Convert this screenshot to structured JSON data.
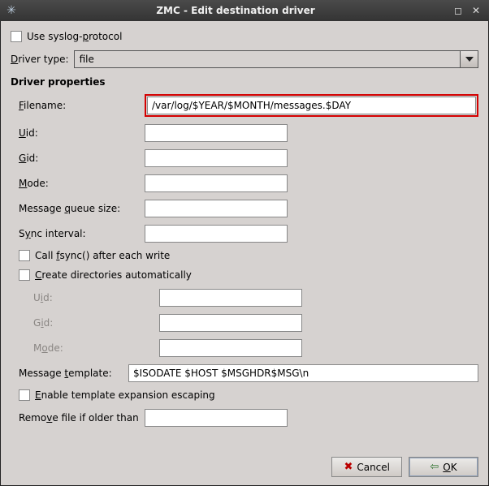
{
  "window": {
    "title": "ZMC - Edit destination driver"
  },
  "syslog_checkbox_label_pre": "Use syslog-",
  "syslog_checkbox_label_u": "p",
  "syslog_checkbox_label_post": "rotocol",
  "driver_type_label_u": "D",
  "driver_type_label_rest": "river type:",
  "driver_type_value": "file",
  "section_title": "Driver properties",
  "fields": {
    "filename_label_pre": "",
    "filename_label_u": "F",
    "filename_label_post": "ilename:",
    "filename_value": "/var/log/$YEAR/$MONTH/messages.$DAY",
    "uid_label_u": "U",
    "uid_label_post": "id:",
    "uid_value": "",
    "gid_label_u": "G",
    "gid_label_post": "id:",
    "gid_value": "",
    "mode_label_u": "M",
    "mode_label_post": "ode:",
    "mode_value": "",
    "mqs_label_pre": "Message ",
    "mqs_label_u": "q",
    "mqs_label_post": "ueue size:",
    "mqs_value": "",
    "sync_label_pre": "S",
    "sync_label_u": "y",
    "sync_label_post": "nc interval:",
    "sync_value": "",
    "fsync_label_pre": "Call ",
    "fsync_label_u": "f",
    "fsync_label_post": "sync() after each write",
    "createdirs_label_u": "C",
    "createdirs_label_post": "reate directories automatically",
    "sub_uid_label_pre": "U",
    "sub_uid_label_u": "i",
    "sub_uid_label_post": "d:",
    "sub_uid_value": "",
    "sub_gid_label_pre": "G",
    "sub_gid_label_u": "i",
    "sub_gid_label_post": "d:",
    "sub_gid_value": "",
    "sub_mode_label_pre": "M",
    "sub_mode_label_u": "o",
    "sub_mode_label_post": "de:",
    "sub_mode_value": "",
    "template_label_pre": "Message ",
    "template_label_u": "t",
    "template_label_post": "emplate:",
    "template_value": "$ISODATE $HOST $MSGHDR$MSG\\n",
    "escape_label_u": "E",
    "escape_label_post": "nable template expansion escaping",
    "remove_label_pre": "Remo",
    "remove_label_u": "v",
    "remove_label_post": "e file if older than",
    "remove_value": ""
  },
  "buttons": {
    "cancel": "Cancel",
    "ok_u": "O",
    "ok_rest": "K"
  }
}
